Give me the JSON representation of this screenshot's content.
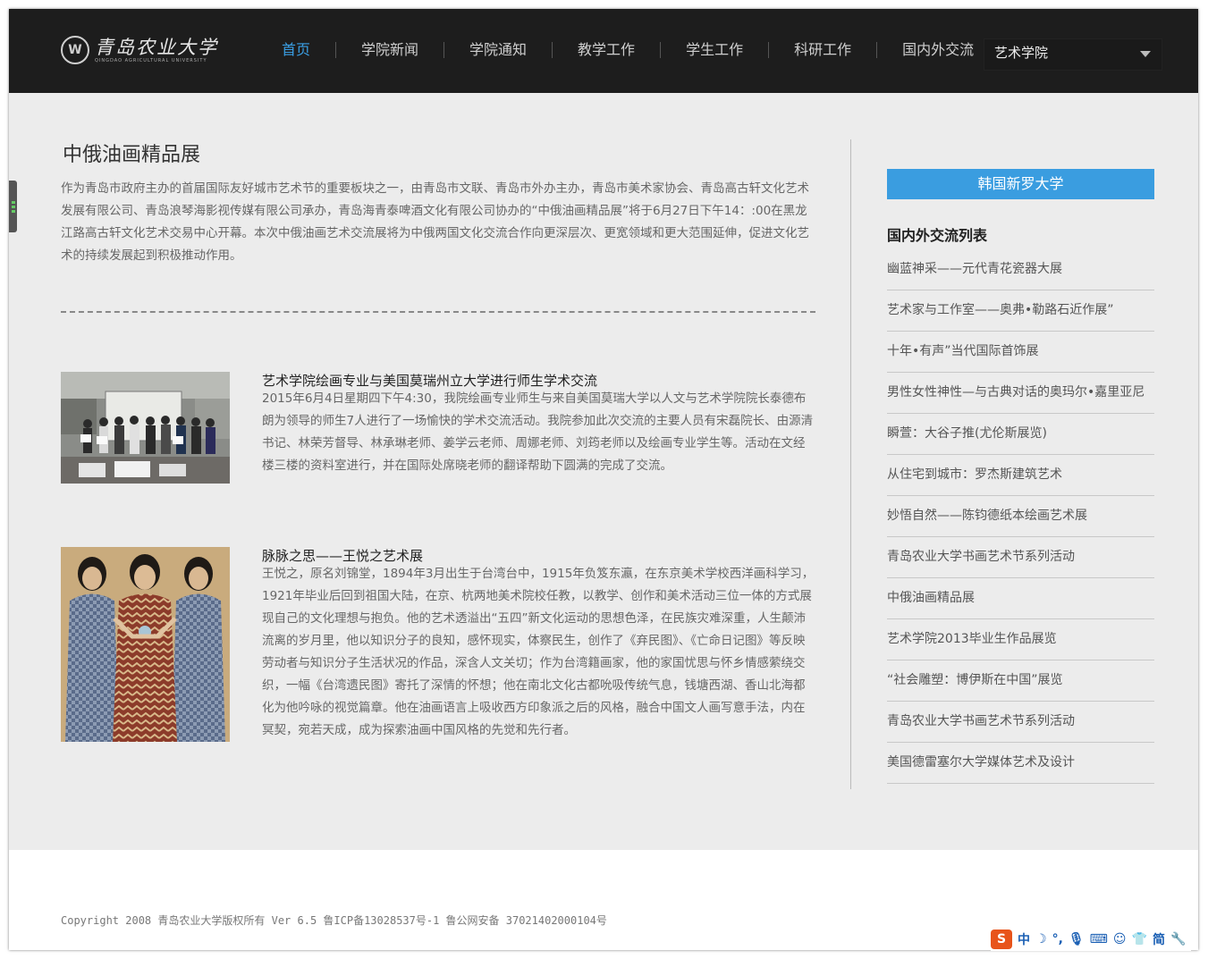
{
  "header": {
    "logo_cn": "青岛农业大学",
    "logo_en": "QINGDAO AGRICULTURAL UNIVERSITY",
    "logo_seal": "W",
    "nav": [
      {
        "label": "首页",
        "active": true
      },
      {
        "label": "学院新闻",
        "active": false
      },
      {
        "label": "学院通知",
        "active": false
      },
      {
        "label": "教学工作",
        "active": false
      },
      {
        "label": "学生工作",
        "active": false
      },
      {
        "label": "科研工作",
        "active": false
      },
      {
        "label": "国内外交流",
        "active": false
      }
    ],
    "college_select": "艺术学院"
  },
  "main": {
    "title": "中俄油画精品展",
    "intro": "作为青岛市政府主办的首届国际友好城市艺术节的重要板块之一，由青岛市文联、青岛市外办主办，青岛市美术家协会、青岛高古轩文化艺术发展有限公司、青岛浪琴海影视传媒有限公司承办，青岛海青泰啤酒文化有限公司协办的“中俄油画精品展”将于6月27日下午14：:00在黑龙江路高古轩文化艺术交易中心开幕。本次中俄油画艺术交流展将为中俄两国文化交流合作向更深层次、更宽领域和更大范围延伸，促进文化艺术的持续发展起到积极推动作用。",
    "articles": [
      {
        "title": "艺术学院绘画专业与美国莫瑞州立大学进行师生学术交流",
        "body": "2015年6月4日星期四下午4:30，我院绘画专业师生与来自美国莫瑞大学以人文与艺术学院院长泰德布朗为领导的师生7人进行了一场愉快的学术交流活动。我院参加此次交流的主要人员有宋磊院长、由源清书记、林荣芳督导、林承琳老师、姜学云老师、周娜老师、刘筠老师以及绘画专业学生等。活动在文经楼三楼的资料室进行，并在国际处席晓老师的翻译帮助下圆满的完成了交流。"
      },
      {
        "title": "脉脉之思——王悦之艺术展",
        "body": "王悦之，原名刘锦堂，1894年3月出生于台湾台中，1915年负笈东瀛，在东京美术学校西洋画科学习， 1921年毕业后回到祖国大陆，在京、杭两地美术院校任教，以教学、创作和美术活动三位一体的方式展现自己的文化理想与抱负。他的艺术透溢出“五四”新文化运动的思想色泽，在民族灾难深重，人生颠沛流离的岁月里，他以知识分子的良知，感怀现实，体察民生，创作了《弃民图》、《亡命日记图》等反映劳动者与知识分子生活状况的作品，深含人文关切；作为台湾籍画家，他的家国忧思与怀乡情感萦绕交织，一幅《台湾遗民图》寄托了深情的怀想；他在南北文化古都吮吸传统气息，钱塘西湖、香山北海都化为他吟咏的视觉篇章。他在油画语言上吸收西方印象派之后的风格，融合中国文人画写意手法，内在冥契，宛若天成，成为探索油画中国风格的先觉和先行者。"
      }
    ]
  },
  "sidebar": {
    "partner_button": "韩国新罗大学",
    "list_title": "国内外交流列表",
    "items": [
      "幽蓝神采——元代青花瓷器大展",
      "艺术家与工作室——奥弗•勒路石近作展”",
      "十年•有声”当代国际首饰展",
      "男性女性神性—与古典对话的奥玛尔•嘉里亚尼",
      "瞬萱：大谷子推(尤伦斯展览)",
      "从住宅到城市：罗杰斯建筑艺术",
      "妙悟自然——陈钧德纸本绘画艺术展",
      "青岛农业大学书画艺术节系列活动",
      "中俄油画精品展",
      "艺术学院2013毕业生作品展览",
      "“社会雕塑：博伊斯在中国”展览",
      "青岛农业大学书画艺术节系列活动",
      "美国德雷塞尔大学媒体艺术及设计"
    ]
  },
  "footer": {
    "copyright": "Copyright 2008 青岛农业大学版权所有 Ver 6.5 鲁ICP备13028537号-1 鲁公网安备 37021402000104号"
  },
  "ime": {
    "logo": "S",
    "mode": "中",
    "punct": "简"
  },
  "colors": {
    "header_bg": "#1d1d1d",
    "nav_active": "#3aa0e6",
    "partner_button_bg": "#3a9de0",
    "page_bg": "#ececec"
  }
}
